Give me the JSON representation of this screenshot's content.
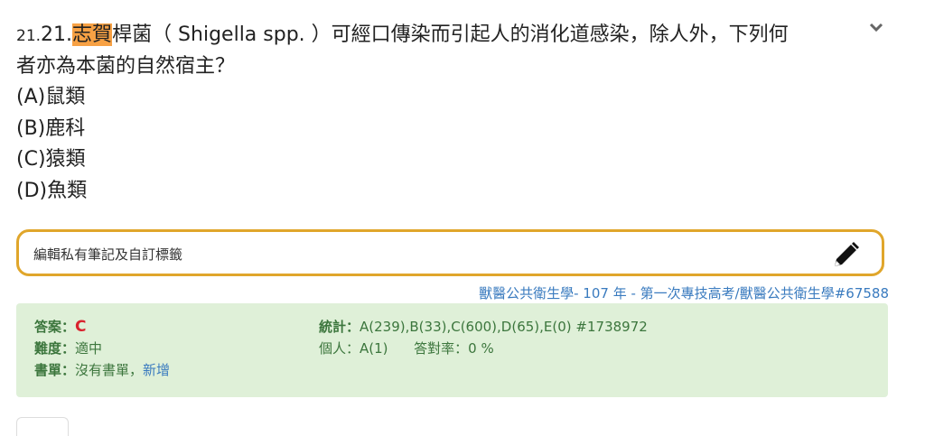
{
  "question": {
    "number_small": "21.",
    "number_big": "21.",
    "highlight": "志賀",
    "text_1": "桿菌（ Shigella spp. ）可經口傳染而引起人的消化道感染，除人外，下列何",
    "text_2": "者亦為本菌的自然宿主？",
    "options": [
      "(A)鼠類",
      "(B)鹿科",
      "(C)猿類",
      "(D)魚類"
    ]
  },
  "note": {
    "placeholder": "編輯私有筆記及自訂標籤"
  },
  "source": {
    "subject": "獸醫公共衛生學",
    "sep1": "- ",
    "year": "107 年",
    "sep2": " - ",
    "exam": "第一次專技高考/獸醫公共衛生學#67588"
  },
  "stats": {
    "answer_label": "答案：",
    "answer_value": "C",
    "difficulty_label": "難度：",
    "difficulty_value": "適中",
    "booklist_label": "書單：",
    "booklist_value": "沒有書單，",
    "booklist_add": "新增",
    "stats_label": "統計：",
    "stats_value": "A(239),B(33),C(600),D(65),E(0) #1738972",
    "personal_label": "個人：",
    "personal_value": "A(1)",
    "rate_label": "答對率：",
    "rate_value": "0 %"
  }
}
